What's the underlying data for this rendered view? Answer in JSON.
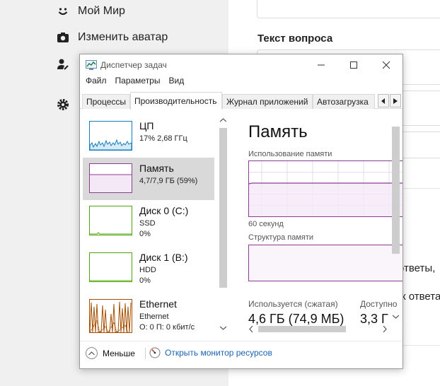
{
  "background": {
    "sidebar": {
      "items": [
        {
          "label": "Мой Мир",
          "icon": "smile-icon"
        },
        {
          "label": "Изменить аватар",
          "icon": "camera-icon"
        },
        {
          "label": "",
          "icon": "user-edit-icon"
        },
        {
          "label": "",
          "icon": "gear-icon"
        }
      ]
    },
    "main": {
      "question_label": "Текст вопроса",
      "fragment_answers": "ответы,",
      "fragment_answer": "к ответа"
    }
  },
  "window": {
    "title": "Диспетчер задач",
    "menu": [
      "Файл",
      "Параметры",
      "Вид"
    ],
    "tabs": [
      "Процессы",
      "Производительность",
      "Журнал приложений",
      "Автозагрузка"
    ],
    "active_tab": "Производительность",
    "list": [
      {
        "name": "ЦП",
        "line1": "17% 2,68 ГГц",
        "line2": "",
        "color": "#117dbb"
      },
      {
        "name": "Память",
        "line1": "4,7/7,9 ГБ (59%)",
        "line2": "",
        "color": "#8b3d96"
      },
      {
        "name": "Диск 0 (C:)",
        "line1": "SSD",
        "line2": "0%",
        "color": "#4da60c"
      },
      {
        "name": "Диск 1 (B:)",
        "line1": "HDD",
        "line2": "0%",
        "color": "#4da60c"
      },
      {
        "name": "Ethernet",
        "line1": "Ethernet",
        "line2": "О: 0 П: 0 кбит/с",
        "color": "#a74f01"
      }
    ],
    "panel": {
      "title": "Память",
      "usage_label": "Использование памяти",
      "time_label": "60 секунд",
      "structure_label": "Структура памяти",
      "in_use_label": "Используется (сжатая)",
      "in_use_value": "4,6 ГБ (74,9 МБ)",
      "available_label": "Доступно",
      "available_value": "3,3 Г"
    },
    "footer": {
      "fewer_label": "Меньше",
      "resource_monitor_label": "Открыть монитор ресурсов"
    }
  }
}
